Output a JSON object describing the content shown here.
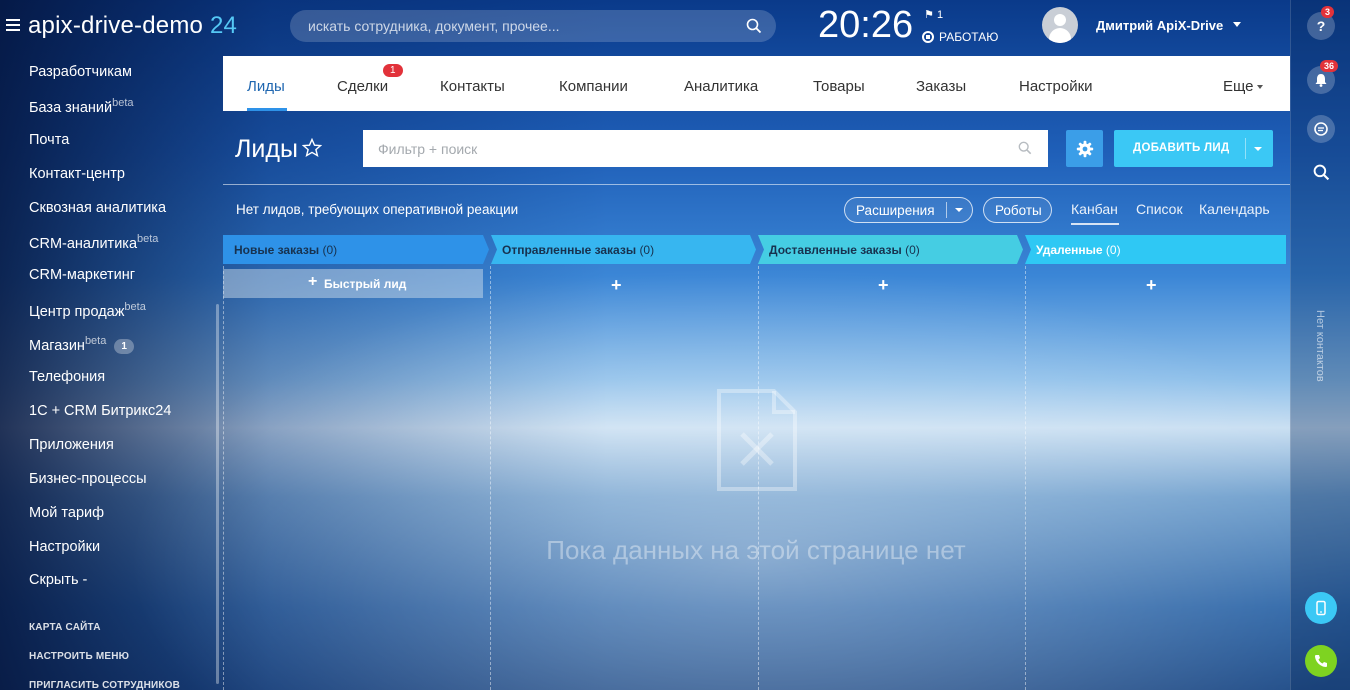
{
  "header": {
    "logo_main": "apix-drive-demo",
    "logo_num": "24",
    "search_placeholder": "искать сотрудника, документ, прочее...",
    "clock": "20:26",
    "flag_count": "1",
    "status": "РАБОТАЮ",
    "user_name": "Дмитрий ApiX-Drive"
  },
  "sidebar": {
    "items": [
      {
        "label": "Разработчикам",
        "sup": ""
      },
      {
        "label": "База знаний",
        "sup": "beta"
      },
      {
        "label": "Почта",
        "sup": ""
      },
      {
        "label": "Контакт-центр",
        "sup": ""
      },
      {
        "label": "Сквозная аналитика",
        "sup": ""
      },
      {
        "label": "CRM-аналитика",
        "sup": "beta"
      },
      {
        "label": "CRM-маркетинг",
        "sup": ""
      },
      {
        "label": "Центр продаж",
        "sup": "beta"
      },
      {
        "label": "Магазин",
        "sup": "beta",
        "count": "1"
      },
      {
        "label": "Телефония",
        "sup": ""
      },
      {
        "label": "1С + CRM Битрикс24",
        "sup": ""
      },
      {
        "label": "Приложения",
        "sup": ""
      },
      {
        "label": "Бизнес-процессы",
        "sup": ""
      },
      {
        "label": "Мой тариф",
        "sup": ""
      },
      {
        "label": "Настройки",
        "sup": ""
      },
      {
        "label": "Скрыть -",
        "sup": ""
      }
    ],
    "links": [
      "КАРТА САЙТА",
      "НАСТРОИТЬ МЕНЮ",
      "ПРИГЛАСИТЬ СОТРУДНИКОВ"
    ]
  },
  "rightbar": {
    "help_badge": "3",
    "notify_badge": "36",
    "vertical_label": "Нет контактов",
    "colors": {
      "phone": "#7ed321",
      "mobile": "#3bc8f5"
    }
  },
  "tabs": {
    "items": [
      "Лиды",
      "Сделки",
      "Контакты",
      "Компании",
      "Аналитика",
      "Товары",
      "Заказы",
      "Настройки",
      "Еще"
    ],
    "deals_badge": "1",
    "active": "Лиды"
  },
  "page": {
    "title": "Лиды",
    "filter_placeholder": "Фильтр + поиск",
    "add_button": "ДОБАВИТЬ ЛИД",
    "notice": "Нет лидов, требующих оперативной реакции",
    "extensions": "Расширения",
    "robots": "Роботы",
    "views": [
      "Канбан",
      "Список",
      "Календарь"
    ],
    "quick_lead": "Быстрый лид",
    "empty_text": "Пока данных на этой странице нет"
  },
  "kanban": {
    "columns": [
      {
        "name": "Новые заказы",
        "count": "(0)",
        "color": "#2e92e8"
      },
      {
        "name": "Отправленные заказы",
        "count": "(0)",
        "color": "#37b6f0"
      },
      {
        "name": "Доставленные заказы",
        "count": "(0)",
        "color": "#45cde3"
      },
      {
        "name": "Удаленные",
        "count": "(0)",
        "color": "#2fc8f4"
      }
    ]
  },
  "colors": {
    "accent": "#2e92e8",
    "add_button": "#3bc8f5",
    "badge": "#e2323a"
  }
}
